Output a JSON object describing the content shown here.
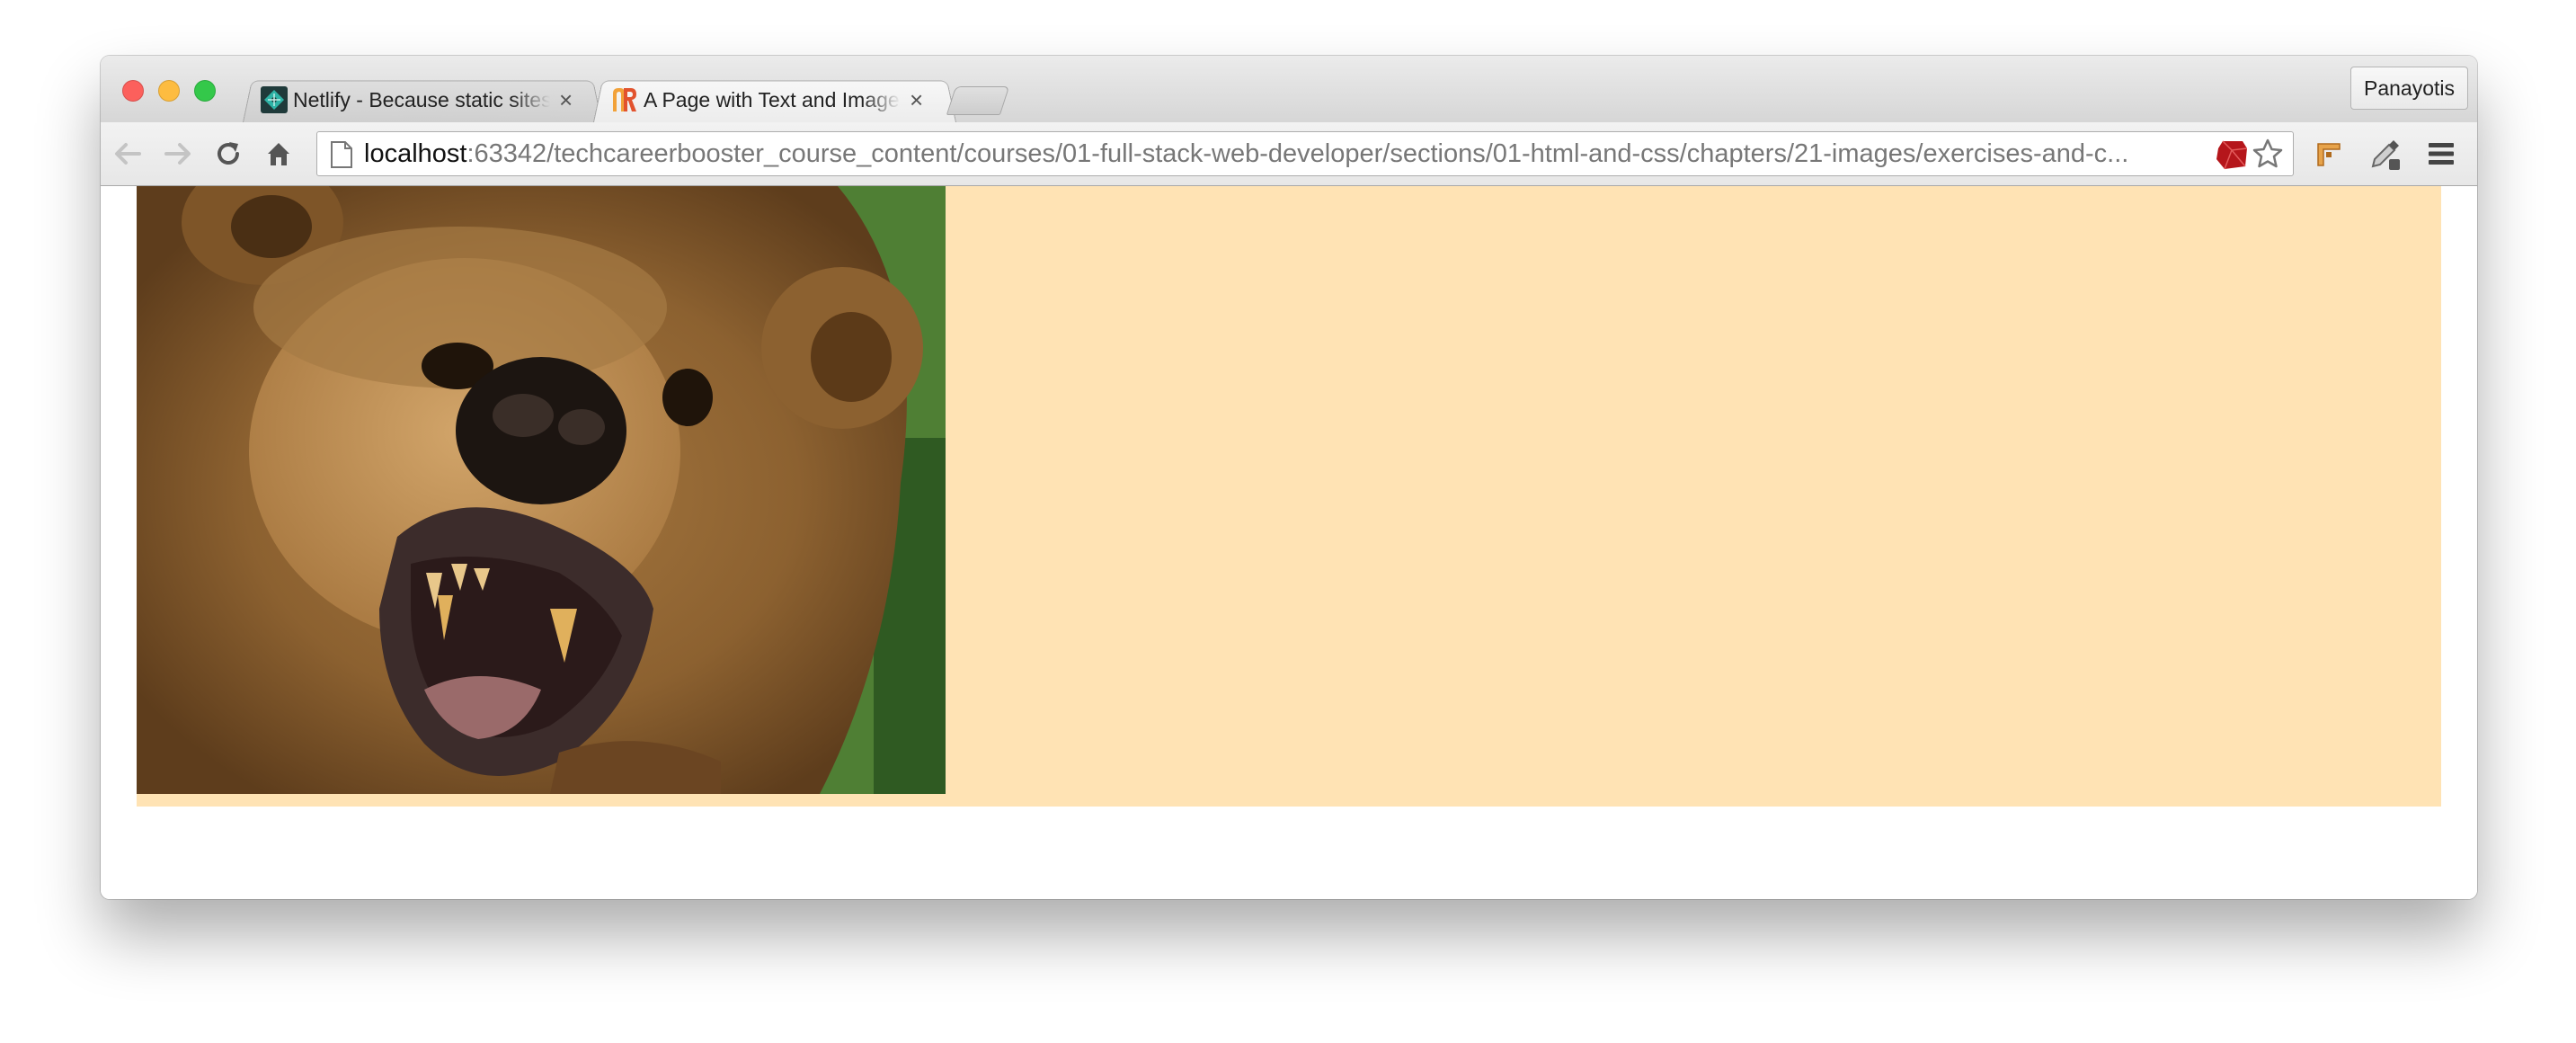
{
  "window": {
    "traffic_lights": [
      "close",
      "minimize",
      "maximize"
    ]
  },
  "tabs": [
    {
      "title": "Netlify - Because static sites",
      "icon": "netlify-favicon",
      "active": false
    },
    {
      "title": "A Page with Text and Images",
      "icon": "techcareerbooster-favicon",
      "active": true
    }
  ],
  "profile": {
    "name": "Panayotis"
  },
  "toolbar": {
    "back_icon": "arrow-left-icon",
    "forward_icon": "arrow-right-icon",
    "reload_icon": "reload-icon",
    "home_icon": "home-icon",
    "url_host": "localhost",
    "url_rest": ":63342/techcareerbooster_course_content/courses/01-full-stack-web-developer/sections/01-html-and-css/chapters/21-images/exercises-and-c...",
    "extensions": [
      "ruby-icon",
      "star-icon",
      "bookmark-pin-icon",
      "eyedropper-icon",
      "menu-icon"
    ]
  },
  "page": {
    "background_color": "#ffe3b4",
    "image": {
      "subject": "bear-photo"
    }
  }
}
